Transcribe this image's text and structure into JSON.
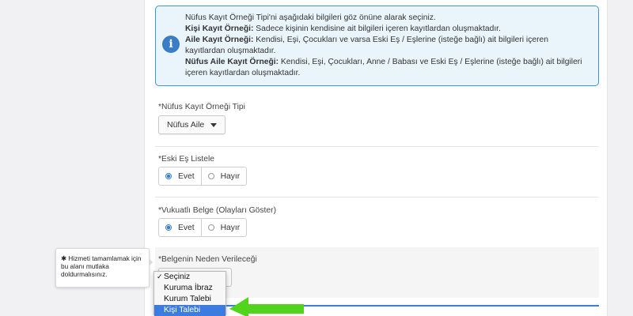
{
  "info": {
    "intro": "Nüfus Kayıt Örneği Tipi'ni aşağıdaki bilgileri göz önüne alarak seçiniz.",
    "items": [
      {
        "term": "Kişi Kayıt Örneği:",
        "desc": " Sadece kişinin kendisine ait bilgileri içeren kayıtlardan oluşmaktadır."
      },
      {
        "term": "Aile Kayıt Örneği:",
        "desc": " Kendisi, Eşi, Çocukları ve varsa Eski Eş / Eşlerine (isteğe bağlı) ait bilgileri içeren kayıtlardan oluşmaktadır."
      },
      {
        "term": "Nüfus Aile Kayıt Örneği:",
        "desc": " Kendisi, Eşi, Çocukları, Anne / Babası ve Eski Eş / Eşlerine (isteğe bağlı) ait bilgileri içeren kayıtlardan oluşmaktadır."
      }
    ]
  },
  "fields": {
    "type_label": "Nüfus Kayıt Örneği Tipi",
    "type_value": "Nüfus Aile",
    "ex_spouse_label": "Eski Eş Listele",
    "vukuatli_label": "Vukuatlı Belge (Olayları Göster)",
    "reason_label": "Belgenin Neden Verileceği",
    "required_mark": "*"
  },
  "radios": {
    "yes": "Evet",
    "no": "Hayır",
    "ex_spouse_selected": "Evet",
    "vukuatli_selected": "Evet"
  },
  "tooltip": {
    "star": "✱",
    "text": "Hizmeti tamamlamak için bu alanı mutlaka doldurmalısınız."
  },
  "dropdown": {
    "options": [
      "Seçiniz",
      "Kuruma İbraz",
      "Kurum Talebi",
      "Kişi Talebi"
    ],
    "checked": "Seçiniz",
    "highlighted": "Kişi Talebi"
  },
  "colors": {
    "accent": "#3a7dc6",
    "info_bg": "#eaf5fb",
    "arrow": "#52d31c"
  },
  "icons": {
    "info": "info-circle-icon",
    "dropdown_caret": "caret-down-icon",
    "pointer_arrow": "green-arrow-icon"
  }
}
